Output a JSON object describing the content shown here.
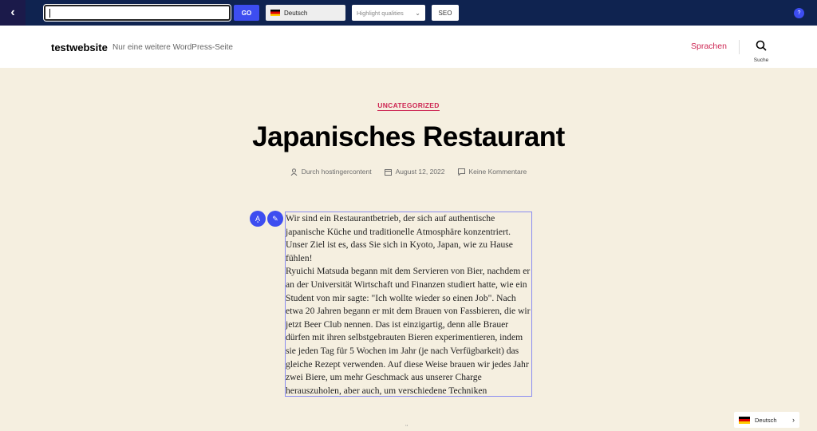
{
  "toolbar": {
    "back": "‹",
    "url_value": "",
    "go": "GO",
    "language": "Deutsch",
    "highlight_placeholder": "Highlight qualities",
    "seo": "SEO",
    "help": "?"
  },
  "header": {
    "site_title": "testwebsite",
    "tagline": "Nur eine weitere WordPress-Seite",
    "nav_link": "Sprachen",
    "search_label": "Suche"
  },
  "post": {
    "category": "UNCATEGORIZED",
    "title": "Japanisches Restaurant",
    "author": "Durch hostingercontent",
    "date": "August 12, 2022",
    "comments": "Keine Kommentare",
    "paragraphs": [
      "Wir sind ein Restaurantbetrieb, der sich auf authentische japanische Küche und traditionelle Atmosphäre konzentriert. Unser Ziel ist es, dass Sie sich in Kyoto, Japan, wie zu Hause fühlen!",
      "Ryuichi Matsuda begann mit dem Servieren von Bier, nachdem er an der Universität Wirtschaft und Finanzen studiert hatte, wie ein Student von mir sagte: \"Ich wollte wieder so einen Job\". Nach etwa 20 Jahren begann er mit dem Brauen von Fassbieren, die wir jetzt Beer Club nennen. Das ist einzigartig, denn alle Brauer dürfen mit ihren selbstgebrauten Bieren experimentieren, indem sie jeden Tag für 5 Wochen im Jahr (je nach Verfügbarkeit) das gleiche Rezept verwenden. Auf diese Weise brauen wir jedes Jahr zwei Biere, um mehr Geschmack aus unserer Charge herauszuholen, aber auch, um verschiedene Techniken auszuprobieren, damit es nicht einen Bissen zu viel oder keinen gibt, obwohl die"
    ]
  },
  "language_switcher": {
    "label": "Deutsch"
  },
  "colors": {
    "accent": "#cd2653",
    "toolbar": "#0f2350",
    "button": "#3d4df0",
    "background": "#f5efe0"
  }
}
